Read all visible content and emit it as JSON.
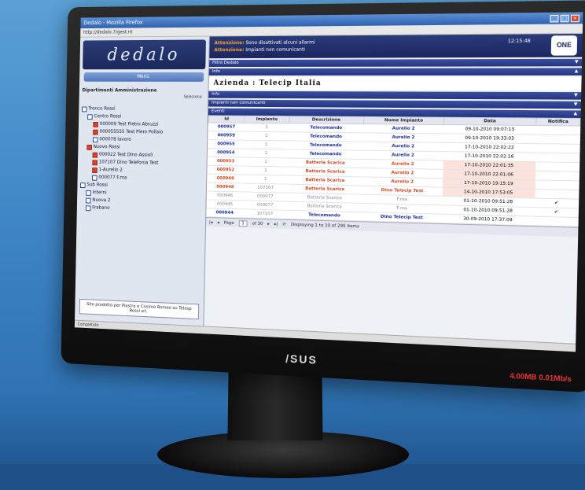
{
  "browser": {
    "title": "Dedalo - Mozilla Firefox",
    "address": "http://dedalo.7/gest.nt"
  },
  "left_panel": {
    "logo": "dedalo",
    "menu_label": "Menù",
    "dept_label": "Dipartimenti Amministrazione",
    "select_all": "Seleziona",
    "tree": [
      {
        "label": "Tronco Rossi",
        "red": false,
        "indent": 0
      },
      {
        "label": "Centro Rossi",
        "red": false,
        "indent": 1
      },
      {
        "label": "000009 Test Pietro Abruzzi",
        "red": true,
        "indent": 2
      },
      {
        "label": "000055555 Test Piero Pollaio",
        "red": true,
        "indent": 2
      },
      {
        "label": "000078 lavoro",
        "red": false,
        "indent": 2
      },
      {
        "label": "Nuovo Rossi",
        "red": true,
        "indent": 1
      },
      {
        "label": "000022 Test Dino Assioli",
        "red": true,
        "indent": 2
      },
      {
        "label": "107107 Dino Telefonia Test",
        "red": true,
        "indent": 2
      },
      {
        "label": "1-Aurelio 2",
        "red": true,
        "indent": 2
      },
      {
        "label": "000077 F.ma",
        "red": false,
        "indent": 2
      },
      {
        "label": "Sub Rossi",
        "red": false,
        "indent": 0
      },
      {
        "label": "Interni",
        "red": false,
        "indent": 1
      },
      {
        "label": "Nuova 2",
        "red": false,
        "indent": 1
      },
      {
        "label": "Frabano",
        "red": false,
        "indent": 1
      }
    ],
    "footer_note": "Sito prodotto per Piastra e Cosimo Romeo su Telesp Rossi srl."
  },
  "header": {
    "alert_1_tag": "Attenzione:",
    "alert_1_text": "Sono disattivati alcuni allarmi",
    "alert_2_tag": "Attenzione:",
    "alert_2_text": "Impianti non comunicanti",
    "time": "12:15:48",
    "brand": "ONE"
  },
  "sections": {
    "top_1": "Filtro Dedalo",
    "top_2": "Info",
    "company_title": "Azienda : Telecip Italia",
    "bar_1": "Info",
    "bar_2": "Impianti non comunicanti",
    "bar_3": "Eventi"
  },
  "table": {
    "headers": [
      "Id",
      "Impianto",
      "Descrizione",
      "Nome Impianto",
      "Data",
      "Notifica"
    ],
    "rows": [
      {
        "id": "000957",
        "imp": "1",
        "desc": "Telecomando",
        "name": "Aurelio 2",
        "date": "09-10-2010 09:07:13",
        "color": "blue",
        "date_hl": false,
        "check": false
      },
      {
        "id": "000959",
        "imp": "1",
        "desc": "Telecomando",
        "name": "Aurelio 2",
        "date": "09-10-2010 19:33:03",
        "color": "blue",
        "date_hl": false,
        "check": false
      },
      {
        "id": "000955",
        "imp": "1",
        "desc": "Telecomando",
        "name": "Aurelio 2",
        "date": "17-10-2010 22:02:22",
        "color": "blue",
        "date_hl": false,
        "check": false
      },
      {
        "id": "000954",
        "imp": "1",
        "desc": "Telecomando",
        "name": "Aurelio 2",
        "date": "17-10-2010 22:02:16",
        "color": "blue",
        "date_hl": false,
        "check": false
      },
      {
        "id": "000953",
        "imp": "1",
        "desc": "Batteria Scarica",
        "name": "Aurelio 2",
        "date": "17-10-2010 22:01:35",
        "color": "red",
        "date_hl": true,
        "check": false
      },
      {
        "id": "000952",
        "imp": "1",
        "desc": "Batteria Scarica",
        "name": "Aurelio 2",
        "date": "17-10-2010 22:01:06",
        "color": "red",
        "date_hl": true,
        "check": false
      },
      {
        "id": "000949",
        "imp": "1",
        "desc": "Batteria Scarica",
        "name": "Aurelio 2",
        "date": "17-10-2010 19:15:19",
        "color": "red",
        "date_hl": true,
        "check": false
      },
      {
        "id": "000948",
        "imp": "107107",
        "desc": "Batteria Scarica",
        "name": "Dino Telecip Test",
        "date": "14-10-2010 17:53:05",
        "color": "red",
        "date_hl": true,
        "check": false
      },
      {
        "id": "000946",
        "imp": "000077",
        "desc": "Batteria Scarica",
        "name": "F.ma",
        "date": "01-10-2010 09:51:28",
        "color": "gray",
        "date_hl": false,
        "check": true
      },
      {
        "id": "000945",
        "imp": "000077",
        "desc": "Batteria Scarica",
        "name": "F.ma",
        "date": "01-10-2010 09:51:28",
        "color": "gray",
        "date_hl": false,
        "check": true
      },
      {
        "id": "000944",
        "imp": "107107",
        "desc": "Telecomando",
        "name": "Dino Telecip Test",
        "date": "30-09-2010 17:37:09",
        "color": "blue",
        "date_hl": false,
        "check": false
      }
    ]
  },
  "pager": {
    "page_label": "Page",
    "page_value": "1",
    "of_label": "of 30",
    "summary": "Displaying 1 to 10 of 295 items"
  },
  "statusbar": "Completato",
  "bezel": {
    "logo": "/SUS",
    "status": "4.00MB 0.01Mb/s"
  },
  "colors": {
    "header_navy": "#1b2660",
    "alert_orange": "#f0a030",
    "row_blue": "#1b2e9a",
    "row_red": "#d2461e"
  }
}
